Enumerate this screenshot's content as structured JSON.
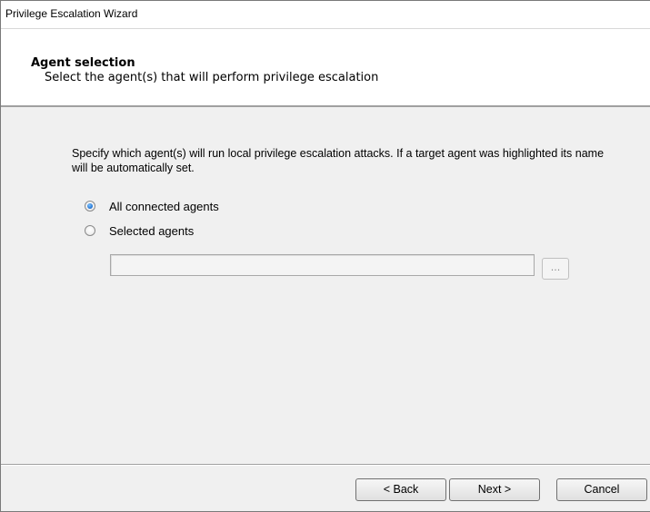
{
  "window": {
    "title": "Privilege Escalation Wizard"
  },
  "header": {
    "title": "Agent selection",
    "subtitle": "Select the agent(s) that will perform privilege escalation"
  },
  "content": {
    "description": "Specify which agent(s) will run local privilege escalation attacks. If a target agent was highlighted its name will be automatically set.",
    "options": [
      {
        "label": "All connected agents",
        "checked": true
      },
      {
        "label": "Selected agents",
        "checked": false
      }
    ],
    "agents_field": {
      "value": ""
    },
    "browse_label": "..."
  },
  "footer": {
    "back_label": "< Back",
    "next_label": "Next >",
    "cancel_label": "Cancel"
  }
}
